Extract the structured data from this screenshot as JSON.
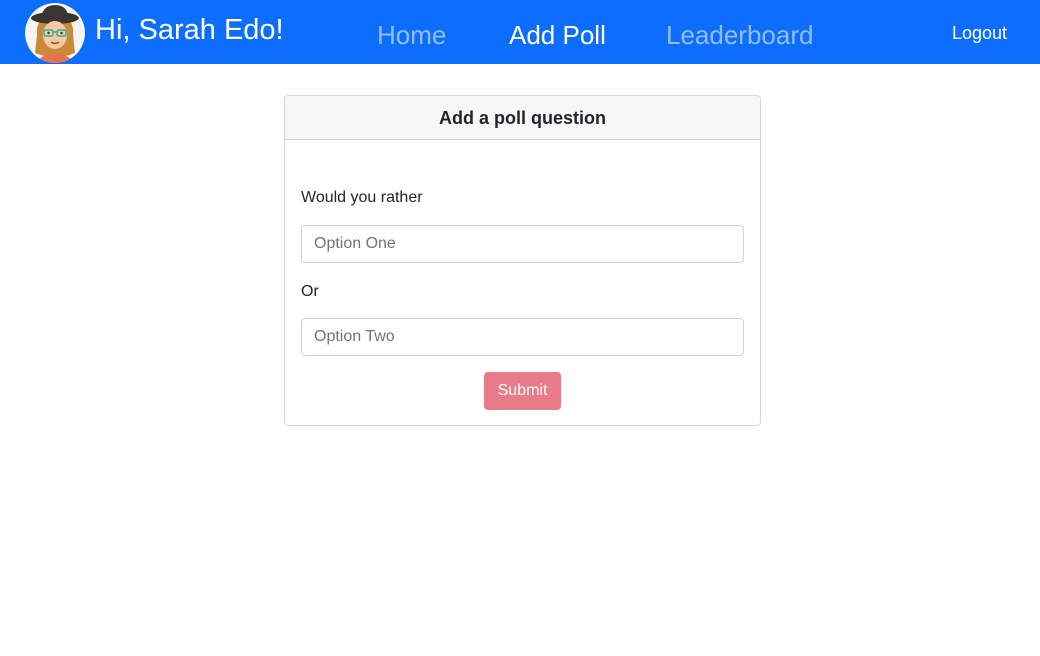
{
  "navbar": {
    "greeting": "Hi, Sarah Edo!",
    "links": [
      {
        "label": "Home",
        "active": false
      },
      {
        "label": "Add Poll",
        "active": true
      },
      {
        "label": "Leaderboard",
        "active": false
      }
    ],
    "logout_label": "Logout",
    "avatar_icon": "woman-with-glasses-avatar"
  },
  "poll_form": {
    "title": "Add a poll question",
    "prompt": "Would you rather",
    "option_one": {
      "value": "",
      "placeholder": "Option One"
    },
    "separator": "Or",
    "option_two": {
      "value": "",
      "placeholder": "Option Two"
    },
    "submit_label": "Submit",
    "submit_disabled": true
  },
  "colors": {
    "navbar_bg": "#0d6efd",
    "submit_bg": "#e87b88"
  }
}
